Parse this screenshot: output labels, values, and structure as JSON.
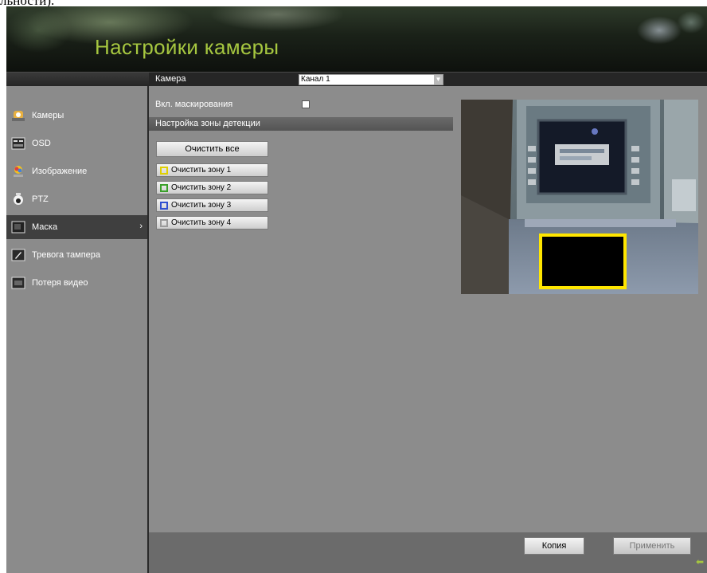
{
  "top_caption": "льности).",
  "header": {
    "title": "Настройки камеры"
  },
  "sidebar": {
    "items": [
      {
        "label": "Камеры",
        "icon": "camera-icon",
        "active": false
      },
      {
        "label": "OSD",
        "icon": "osd-icon",
        "active": false
      },
      {
        "label": "Изображение",
        "icon": "image-icon",
        "active": false
      },
      {
        "label": "PTZ",
        "icon": "ptz-icon",
        "active": false
      },
      {
        "label": "Маска",
        "icon": "mask-icon",
        "active": true
      },
      {
        "label": "Тревога тампера",
        "icon": "tamper-icon",
        "active": false
      },
      {
        "label": "Потеря видео",
        "icon": "video-loss-icon",
        "active": false
      }
    ]
  },
  "main": {
    "camera_label": "Камера",
    "camera_value": "Канал 1",
    "mask_enable_label": "Вкл. маскирования",
    "mask_enabled": false,
    "zone_section_title": "Настройка зоны детекции",
    "clear_all_label": "Очистить все",
    "zones": [
      {
        "label": "Очистить зону 1",
        "color": "#e0d000"
      },
      {
        "label": "Очистить зону 2",
        "color": "#3aa02a"
      },
      {
        "label": "Очистить зону 3",
        "color": "#3050d0"
      },
      {
        "label": "Очистить зону 4",
        "color": "#9a9a9a"
      }
    ]
  },
  "footer": {
    "copy_label": "Копия",
    "apply_label": "Применить"
  },
  "colors": {
    "title_green": "#a6c740",
    "mask_box": "#ffe600"
  }
}
